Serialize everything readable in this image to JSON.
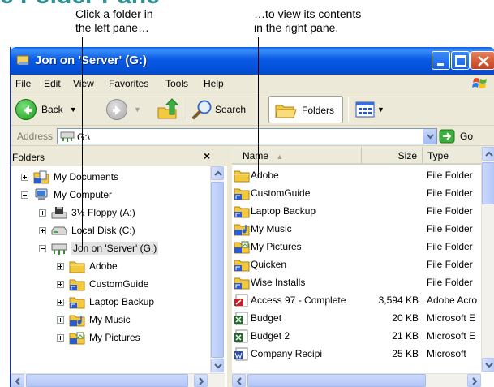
{
  "slide": {
    "heading": "e Folder Pane",
    "callout_left": [
      "Click a folder in",
      "the left pane…"
    ],
    "callout_right": [
      "…to view its contents",
      "in the right pane."
    ]
  },
  "window": {
    "title": "Jon on 'Server' (G:)",
    "menu": [
      "File",
      "Edit",
      "View",
      "Favorites",
      "Tools",
      "Help"
    ],
    "toolbar": {
      "back": "Back",
      "search": "Search",
      "folders": "Folders"
    },
    "address": {
      "label": "Address",
      "value": "G:\\",
      "go": "Go"
    }
  },
  "folders_pane": {
    "title": "Folders",
    "close": "×",
    "tree": [
      {
        "label": "My Documents",
        "expander": "plus",
        "icon": "my-documents-icon",
        "indent": 0
      },
      {
        "label": "My Computer",
        "expander": "minus",
        "icon": "my-computer-icon",
        "indent": 0
      },
      {
        "label": "3½ Floppy (A:)",
        "expander": "plus",
        "icon": "floppy-drive-icon",
        "indent": 1
      },
      {
        "label": "Local Disk (C:)",
        "expander": "plus",
        "icon": "local-disk-icon",
        "indent": 1
      },
      {
        "label": "Jon on 'Server' (G:)",
        "expander": "minus",
        "icon": "network-drive-icon",
        "indent": 1,
        "selected": true
      },
      {
        "label": "Adobe",
        "expander": "plus",
        "icon": "folder-icon",
        "indent": 2
      },
      {
        "label": "CustomGuide",
        "expander": "plus",
        "icon": "shared-folder-icon",
        "indent": 2
      },
      {
        "label": "Laptop Backup",
        "expander": "plus",
        "icon": "shared-folder-icon",
        "indent": 2
      },
      {
        "label": "My Music",
        "expander": "plus",
        "icon": "music-folder-icon",
        "indent": 2
      },
      {
        "label": "My Pictures",
        "expander": "plus",
        "icon": "pictures-folder-icon",
        "indent": 2
      }
    ]
  },
  "files_pane": {
    "columns": {
      "name": "Name",
      "size": "Size",
      "type": "Type"
    },
    "rows": [
      {
        "name": "Adobe",
        "size": "",
        "type": "File Folder",
        "icon": "folder-icon"
      },
      {
        "name": "CustomGuide",
        "size": "",
        "type": "File Folder",
        "icon": "shared-folder-icon"
      },
      {
        "name": "Laptop Backup",
        "size": "",
        "type": "File Folder",
        "icon": "shared-folder-icon"
      },
      {
        "name": "My Music",
        "size": "",
        "type": "File Folder",
        "icon": "music-folder-icon"
      },
      {
        "name": "My Pictures",
        "size": "",
        "type": "File Folder",
        "icon": "pictures-folder-icon"
      },
      {
        "name": "Quicken",
        "size": "",
        "type": "File Folder",
        "icon": "shared-folder-icon"
      },
      {
        "name": "Wise Installs",
        "size": "",
        "type": "File Folder",
        "icon": "shared-folder-icon"
      },
      {
        "name": "Access 97 - Complete",
        "size": "3,594 KB",
        "type": "Adobe Acro",
        "icon": "pdf-file-icon"
      },
      {
        "name": "Budget",
        "size": "20 KB",
        "type": "Microsoft E",
        "icon": "excel-file-icon"
      },
      {
        "name": "Budget 2",
        "size": "21 KB",
        "type": "Microsoft E",
        "icon": "excel-file-icon"
      },
      {
        "name": "Company Recipi",
        "size": "25 KB",
        "type": "Microsoft",
        "icon": "word-file-icon"
      }
    ]
  }
}
